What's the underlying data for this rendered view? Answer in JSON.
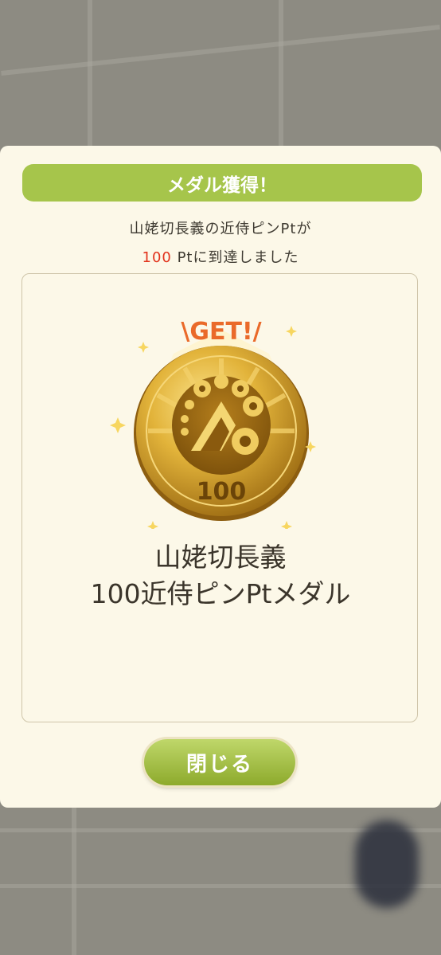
{
  "dialog": {
    "title": "メダル獲得！",
    "message_line1": "山姥切長義の近侍ピンPtが",
    "message_points": "100",
    "message_line2_rest": " Ptに到達しました"
  },
  "medal": {
    "get_label": "\\GET!/",
    "value": "100",
    "name_line1": "山姥切長義",
    "name_line2": "100近侍ピンPtメダル"
  },
  "close_button": {
    "label": "閉じる"
  },
  "colors": {
    "header_green": "#a6c54b",
    "points_red": "#e2331c",
    "get_orange": "#ea6a2a",
    "gold": "#d9a82a"
  }
}
